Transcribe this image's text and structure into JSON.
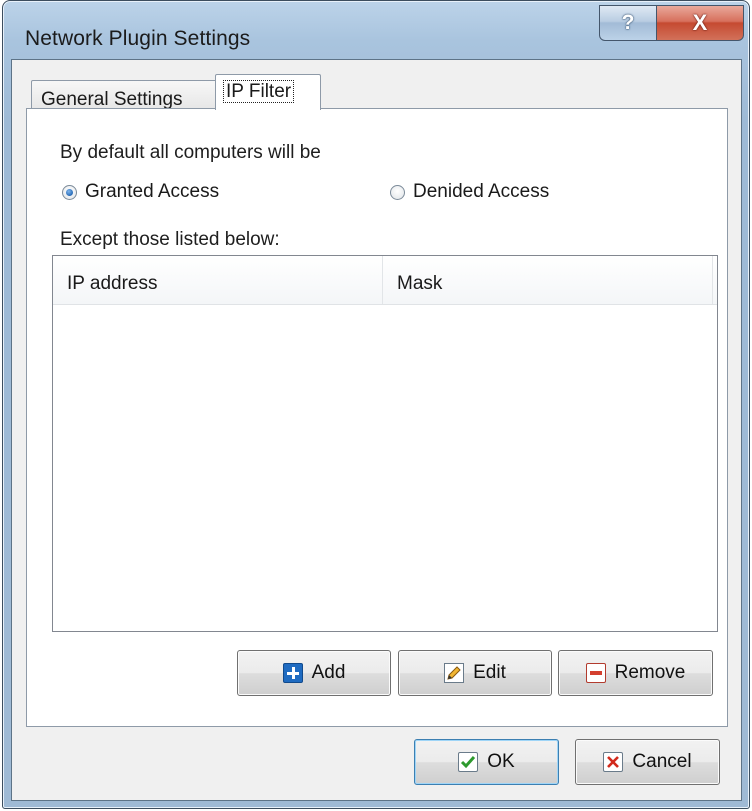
{
  "window": {
    "title": "Network Plugin Settings"
  },
  "caption_buttons": {
    "help": "?",
    "close": "X"
  },
  "tabs": [
    {
      "label": "General Settings",
      "selected": false
    },
    {
      "label": "IP Filter",
      "selected": true
    }
  ],
  "ip_filter": {
    "default_label": "By default all computers will be",
    "radio_granted": {
      "label": "Granted Access",
      "checked": true
    },
    "radio_denied": {
      "label": "Denided Access",
      "checked": false
    },
    "except_label": "Except those listed below:",
    "columns": [
      "IP address",
      "Mask"
    ],
    "rows": []
  },
  "list_buttons": {
    "add": "Add",
    "edit": "Edit",
    "remove": "Remove"
  },
  "footer_buttons": {
    "ok": "OK",
    "cancel": "Cancel"
  },
  "icons": {
    "add": "plus-icon",
    "edit": "pencil-icon",
    "remove": "minus-icon",
    "ok": "checkmark-icon",
    "cancel": "x-icon"
  },
  "colors": {
    "title_bar": "#a9c4de",
    "close_button": "#c54a31",
    "add_icon": "#1f6bc1",
    "remove_icon": "#d4402f",
    "ok_check": "#2e9a2e",
    "cancel_x": "#d22a1c"
  }
}
